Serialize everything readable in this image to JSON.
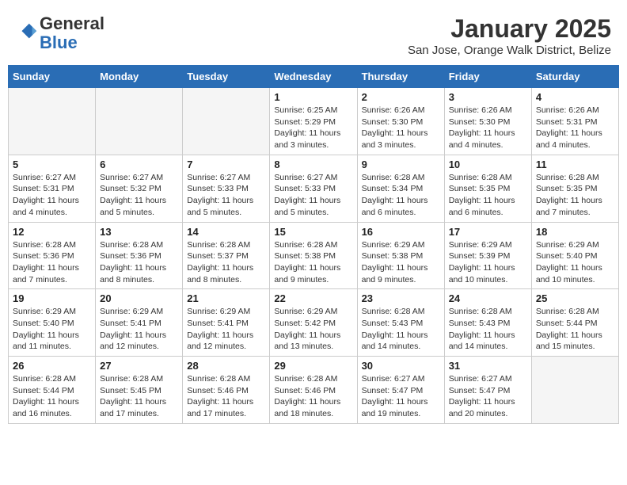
{
  "header": {
    "logo_general": "General",
    "logo_blue": "Blue",
    "title": "January 2025",
    "subtitle": "San Jose, Orange Walk District, Belize"
  },
  "days_of_week": [
    "Sunday",
    "Monday",
    "Tuesday",
    "Wednesday",
    "Thursday",
    "Friday",
    "Saturday"
  ],
  "weeks": [
    [
      {
        "day": "",
        "info": ""
      },
      {
        "day": "",
        "info": ""
      },
      {
        "day": "",
        "info": ""
      },
      {
        "day": "1",
        "info": "Sunrise: 6:25 AM\nSunset: 5:29 PM\nDaylight: 11 hours\nand 3 minutes."
      },
      {
        "day": "2",
        "info": "Sunrise: 6:26 AM\nSunset: 5:30 PM\nDaylight: 11 hours\nand 3 minutes."
      },
      {
        "day": "3",
        "info": "Sunrise: 6:26 AM\nSunset: 5:30 PM\nDaylight: 11 hours\nand 4 minutes."
      },
      {
        "day": "4",
        "info": "Sunrise: 6:26 AM\nSunset: 5:31 PM\nDaylight: 11 hours\nand 4 minutes."
      }
    ],
    [
      {
        "day": "5",
        "info": "Sunrise: 6:27 AM\nSunset: 5:31 PM\nDaylight: 11 hours\nand 4 minutes."
      },
      {
        "day": "6",
        "info": "Sunrise: 6:27 AM\nSunset: 5:32 PM\nDaylight: 11 hours\nand 5 minutes."
      },
      {
        "day": "7",
        "info": "Sunrise: 6:27 AM\nSunset: 5:33 PM\nDaylight: 11 hours\nand 5 minutes."
      },
      {
        "day": "8",
        "info": "Sunrise: 6:27 AM\nSunset: 5:33 PM\nDaylight: 11 hours\nand 5 minutes."
      },
      {
        "day": "9",
        "info": "Sunrise: 6:28 AM\nSunset: 5:34 PM\nDaylight: 11 hours\nand 6 minutes."
      },
      {
        "day": "10",
        "info": "Sunrise: 6:28 AM\nSunset: 5:35 PM\nDaylight: 11 hours\nand 6 minutes."
      },
      {
        "day": "11",
        "info": "Sunrise: 6:28 AM\nSunset: 5:35 PM\nDaylight: 11 hours\nand 7 minutes."
      }
    ],
    [
      {
        "day": "12",
        "info": "Sunrise: 6:28 AM\nSunset: 5:36 PM\nDaylight: 11 hours\nand 7 minutes."
      },
      {
        "day": "13",
        "info": "Sunrise: 6:28 AM\nSunset: 5:36 PM\nDaylight: 11 hours\nand 8 minutes."
      },
      {
        "day": "14",
        "info": "Sunrise: 6:28 AM\nSunset: 5:37 PM\nDaylight: 11 hours\nand 8 minutes."
      },
      {
        "day": "15",
        "info": "Sunrise: 6:28 AM\nSunset: 5:38 PM\nDaylight: 11 hours\nand 9 minutes."
      },
      {
        "day": "16",
        "info": "Sunrise: 6:29 AM\nSunset: 5:38 PM\nDaylight: 11 hours\nand 9 minutes."
      },
      {
        "day": "17",
        "info": "Sunrise: 6:29 AM\nSunset: 5:39 PM\nDaylight: 11 hours\nand 10 minutes."
      },
      {
        "day": "18",
        "info": "Sunrise: 6:29 AM\nSunset: 5:40 PM\nDaylight: 11 hours\nand 10 minutes."
      }
    ],
    [
      {
        "day": "19",
        "info": "Sunrise: 6:29 AM\nSunset: 5:40 PM\nDaylight: 11 hours\nand 11 minutes."
      },
      {
        "day": "20",
        "info": "Sunrise: 6:29 AM\nSunset: 5:41 PM\nDaylight: 11 hours\nand 12 minutes."
      },
      {
        "day": "21",
        "info": "Sunrise: 6:29 AM\nSunset: 5:41 PM\nDaylight: 11 hours\nand 12 minutes."
      },
      {
        "day": "22",
        "info": "Sunrise: 6:29 AM\nSunset: 5:42 PM\nDaylight: 11 hours\nand 13 minutes."
      },
      {
        "day": "23",
        "info": "Sunrise: 6:28 AM\nSunset: 5:43 PM\nDaylight: 11 hours\nand 14 minutes."
      },
      {
        "day": "24",
        "info": "Sunrise: 6:28 AM\nSunset: 5:43 PM\nDaylight: 11 hours\nand 14 minutes."
      },
      {
        "day": "25",
        "info": "Sunrise: 6:28 AM\nSunset: 5:44 PM\nDaylight: 11 hours\nand 15 minutes."
      }
    ],
    [
      {
        "day": "26",
        "info": "Sunrise: 6:28 AM\nSunset: 5:44 PM\nDaylight: 11 hours\nand 16 minutes."
      },
      {
        "day": "27",
        "info": "Sunrise: 6:28 AM\nSunset: 5:45 PM\nDaylight: 11 hours\nand 17 minutes."
      },
      {
        "day": "28",
        "info": "Sunrise: 6:28 AM\nSunset: 5:46 PM\nDaylight: 11 hours\nand 17 minutes."
      },
      {
        "day": "29",
        "info": "Sunrise: 6:28 AM\nSunset: 5:46 PM\nDaylight: 11 hours\nand 18 minutes."
      },
      {
        "day": "30",
        "info": "Sunrise: 6:27 AM\nSunset: 5:47 PM\nDaylight: 11 hours\nand 19 minutes."
      },
      {
        "day": "31",
        "info": "Sunrise: 6:27 AM\nSunset: 5:47 PM\nDaylight: 11 hours\nand 20 minutes."
      },
      {
        "day": "",
        "info": ""
      }
    ]
  ]
}
